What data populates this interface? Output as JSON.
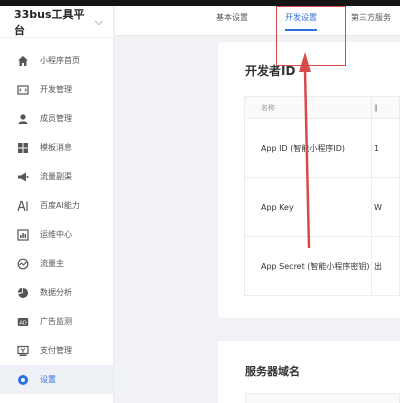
{
  "brand": {
    "title": "33bus工具平台",
    "chevron": "⌵"
  },
  "menu": [
    {
      "label": "小程序首页",
      "icon": "home-icon"
    },
    {
      "label": "开发管理",
      "icon": "code-icon"
    },
    {
      "label": "成员管理",
      "icon": "user-icon"
    },
    {
      "label": "模板消息",
      "icon": "template-icon"
    },
    {
      "label": "流量副渠",
      "icon": "megaphone-icon"
    },
    {
      "label": "百度AI能力",
      "icon": "ai-icon"
    },
    {
      "label": "运维中心",
      "icon": "monitor-icon"
    },
    {
      "label": "流量主",
      "icon": "traffic-icon"
    },
    {
      "label": "数据分析",
      "icon": "pie-chart-icon"
    },
    {
      "label": "广告监测",
      "icon": "ad-icon"
    },
    {
      "label": "支付管理",
      "icon": "payment-icon"
    },
    {
      "label": "设置",
      "icon": "settings-icon",
      "active": true
    }
  ],
  "tabs": [
    {
      "label": "基本设置"
    },
    {
      "label": "开发设置",
      "active": true
    },
    {
      "label": "第三方服务"
    }
  ],
  "developer": {
    "title": "开发者ID",
    "header_name": "名称",
    "header_value": "‖",
    "rows": [
      {
        "name": "App ID (智能小程序ID)",
        "value": "1"
      },
      {
        "name": "App Key",
        "value": "W"
      },
      {
        "name": "App Secret (智能小程序密钥)",
        "value": "出"
      }
    ]
  },
  "server": {
    "title": "服务器域名"
  },
  "colors": {
    "accent": "#2f6fe3",
    "annotation": "#d94a4a"
  }
}
